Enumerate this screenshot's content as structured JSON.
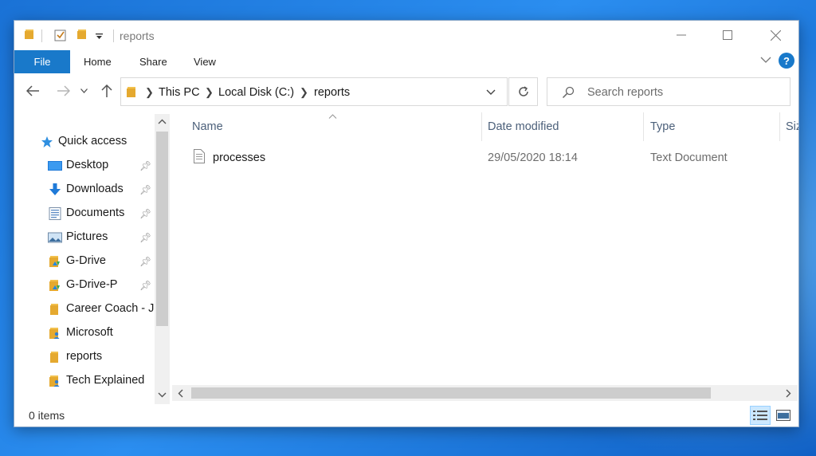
{
  "window": {
    "title": "reports"
  },
  "ribbon": {
    "tabs": [
      {
        "label": "File"
      },
      {
        "label": "Home"
      },
      {
        "label": "Share"
      },
      {
        "label": "View"
      }
    ],
    "help_label": "?"
  },
  "address": {
    "breadcrumbs": [
      "This PC",
      "Local Disk (C:)",
      "reports"
    ],
    "search_placeholder": "Search reports"
  },
  "nav": {
    "quick_access": "Quick access",
    "items": [
      {
        "label": "Desktop",
        "icon": "desktop-icon",
        "pinned": true
      },
      {
        "label": "Downloads",
        "icon": "download-arrow-icon",
        "pinned": true
      },
      {
        "label": "Documents",
        "icon": "documents-icon",
        "pinned": true
      },
      {
        "label": "Pictures",
        "icon": "pictures-icon",
        "pinned": true
      },
      {
        "label": "G-Drive",
        "icon": "gdrive-folder-icon",
        "pinned": true
      },
      {
        "label": "G-Drive-P",
        "icon": "gdrive-folder-icon",
        "pinned": true
      },
      {
        "label": "Career Coach - Jo",
        "icon": "folder-icon",
        "pinned": false
      },
      {
        "label": "Microsoft",
        "icon": "user-folder-icon",
        "pinned": false
      },
      {
        "label": "reports",
        "icon": "folder-icon",
        "pinned": false
      },
      {
        "label": "Tech Explained",
        "icon": "user-folder-icon",
        "pinned": false
      }
    ]
  },
  "columns": {
    "name": "Name",
    "date_modified": "Date modified",
    "type": "Type",
    "size": "Siz"
  },
  "files": [
    {
      "name": "processes",
      "date_modified": "29/05/2020 18:14",
      "type": "Text Document",
      "icon": "text-file-icon"
    }
  ],
  "status": {
    "items_count": "0 items"
  },
  "colors": {
    "accent": "#1979ca",
    "folder": "#f2c14e",
    "desktop_bg": "#1a72d6"
  }
}
